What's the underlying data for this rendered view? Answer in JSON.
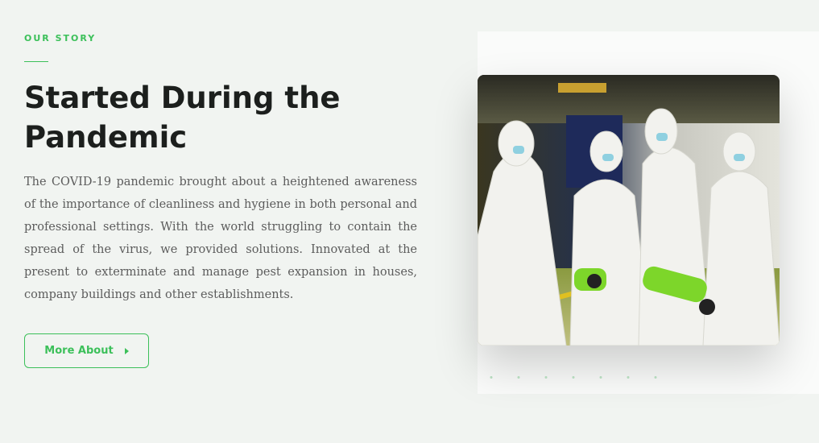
{
  "section": {
    "eyebrow": "OUR STORY",
    "title": "Started During the Pandemic",
    "paragraph": "The COVID-19 pandemic brought about a heightened awareness of the importance of cleanliness and hygiene in both personal and professional settings. With the world struggling to contain the spread of the virus, we provided solutions. Innovated at the present to exterminate and manage pest expansion in houses, company buildings and other establishments.",
    "button_label": "More About",
    "button_icon": "caret-right-icon"
  },
  "colors": {
    "accent": "#3cc05a",
    "heading": "#1c1f1d",
    "text": "#5c5c5c",
    "background": "#f1f4f1"
  },
  "image": {
    "subject": "team-in-protective-suits-photo"
  }
}
